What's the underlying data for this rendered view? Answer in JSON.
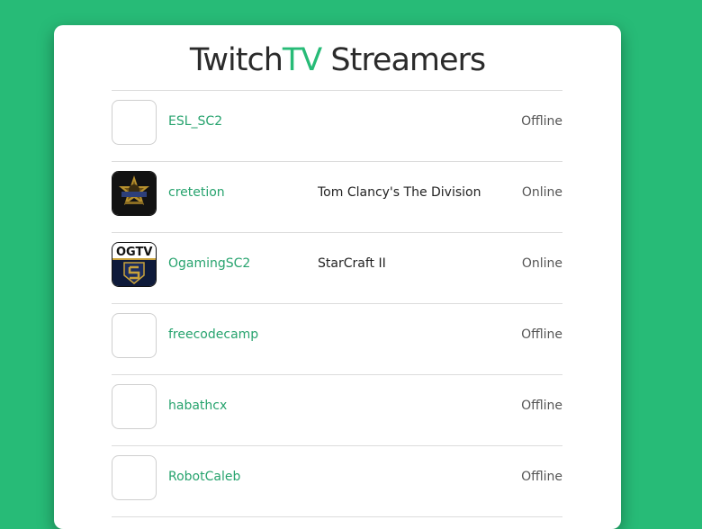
{
  "header": {
    "title_part1": "Twitch",
    "title_accent": "TV",
    "title_part2": " Streamers"
  },
  "streamers": [
    {
      "name": "ESL_SC2",
      "game": "",
      "status": "Offline",
      "avatar": "blank"
    },
    {
      "name": "cretetion",
      "game": "Tom Clancy's The Division",
      "status": "Online",
      "avatar": "cretetion-badge-logo"
    },
    {
      "name": "OgamingSC2",
      "game": "StarCraft II",
      "status": "Online",
      "avatar": "ogtv-logo"
    },
    {
      "name": "freecodecamp",
      "game": "",
      "status": "Offline",
      "avatar": "blank"
    },
    {
      "name": "habathcx",
      "game": "",
      "status": "Offline",
      "avatar": "blank"
    },
    {
      "name": "RobotCaleb",
      "game": "",
      "status": "Offline",
      "avatar": "blank"
    }
  ],
  "colors": {
    "background": "#27bb77",
    "accent": "#27bb77",
    "link": "#27a36e"
  },
  "logos": {
    "ogtv_text": "OGTV"
  }
}
